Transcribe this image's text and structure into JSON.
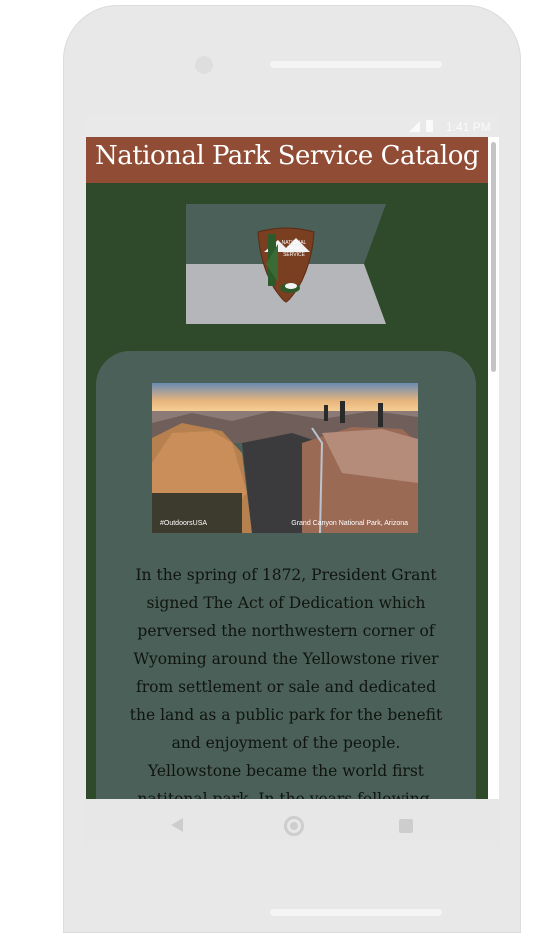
{
  "status_bar": {
    "time": "1:41 PM",
    "icons": [
      "signal-icon",
      "battery-icon"
    ]
  },
  "app": {
    "title": "National Park Service Catalog",
    "logo_text": "NATIONAL PARK SERVICE",
    "photo": {
      "tag": "#OutdoorsUSA",
      "location": "Grand Canyon National Park, Arizona"
    },
    "description": "In the spring of 1872, President Grant signed The Act of Dedication which perversed the northwestern corner of Wyoming around the Yellowstone river from settlement or sale and dedicated the land as a public park for the benefit and enjoyment of the people. Yellowstone became the world first natitonal park. In the years following, this concept of"
  },
  "nav_bar": {
    "icons": [
      "back-icon",
      "home-icon",
      "recent-apps-icon"
    ]
  },
  "colors": {
    "title_bar": "#914c35",
    "app_background": "#2e4a2a",
    "card": "#4a6058",
    "banner_top": "#4a6058",
    "banner_bottom": "#b5b6ba"
  }
}
